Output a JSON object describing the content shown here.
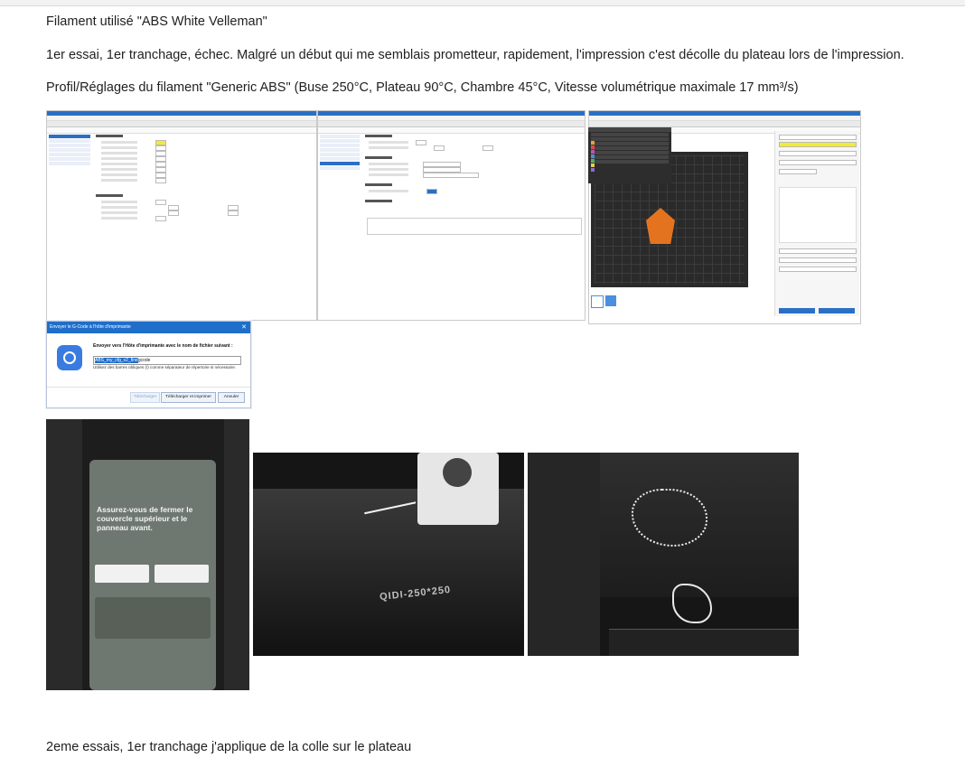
{
  "paragraphs": {
    "filament": "Filament utilisé \"ABS White Velleman\"",
    "essai1": "1er essai, 1er tranchage, échec. Malgré un début qui me semblais prometteur, rapidement, l'impression c'est décolle du plateau lors de l'impression.",
    "profil": "Profil/Réglages du filament \"Generic ABS\" (Buse 250°C, Plateau 90°C, Chambre 45°C, Vitesse volumétrique maximale 17 mm³/s)",
    "essai2": "2eme essais, 1er tranchage j'applique de la colle sur le plateau"
  },
  "dialog": {
    "title": "Envoyer le G-Code à l'hôte d'imprimante",
    "close": "✕",
    "prompt": "Envoyer vers l'Hôte d'imprimante avec le nom de fichier suivant :",
    "filename_selected": "ABS_my_cfg_v2_first",
    "filename_rest": "gcode",
    "hint": "Utilisez des barres obliques (/) comme séparateur de répertoire si nécessaire.",
    "buttons": {
      "upload": "Télécharger",
      "upload_print": "Télécharger et imprimer",
      "cancel": "Annuler"
    }
  },
  "printer_screen": {
    "message": "Assurez-vous de fermer le couvercle supérieur et le panneau avant."
  },
  "bed_label": "QIDI-250*250",
  "colors": {
    "slicer_accent": "#2b6fc5",
    "part": "#e4731f"
  }
}
